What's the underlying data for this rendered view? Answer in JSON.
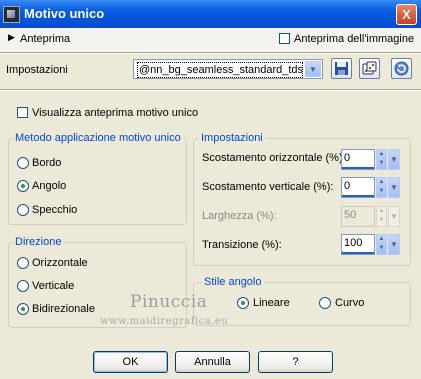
{
  "window": {
    "title": "Motivo unico",
    "close_label": "X"
  },
  "preview": {
    "toggle_label": "Anteprima",
    "image_preview_label": "Anteprima dell'immagine",
    "image_preview_checked": false
  },
  "presets": {
    "label": "Impostazioni",
    "value": "@nn_bg_seamless_standard_tdst...",
    "save_icon": "floppy-disk-icon",
    "random_icon": "dice-icon",
    "reset_icon": "reset-icon"
  },
  "visualize": {
    "label": "Visualizza anteprima motivo unico",
    "checked": false
  },
  "method": {
    "title": "Metodo applicazione motivo unico",
    "options": [
      "Bordo",
      "Angolo",
      "Specchio"
    ],
    "selected": "Angolo"
  },
  "settings": {
    "title": "Impostazioni",
    "h_offset_label": "Scostamento orizzontale (%):",
    "h_offset_value": "0",
    "v_offset_label": "Scostamento verticale (%):",
    "v_offset_value": "0",
    "width_label": "Larghezza (%):",
    "width_value": "50",
    "transition_label": "Transizione (%):",
    "transition_value": "100"
  },
  "direction": {
    "title": "Direzione",
    "options": [
      "Orizzontale",
      "Verticale",
      "Bidirezionale"
    ],
    "selected": "Bidirezionale"
  },
  "angle_style": {
    "title": "Stile angolo",
    "options": [
      "Lineare",
      "Curvo"
    ],
    "selected": "Lineare"
  },
  "watermark": {
    "name": "Pinuccia",
    "url": "www.maidiregrafica.eu"
  },
  "buttons": {
    "ok": "OK",
    "cancel": "Annulla",
    "help": "?"
  }
}
